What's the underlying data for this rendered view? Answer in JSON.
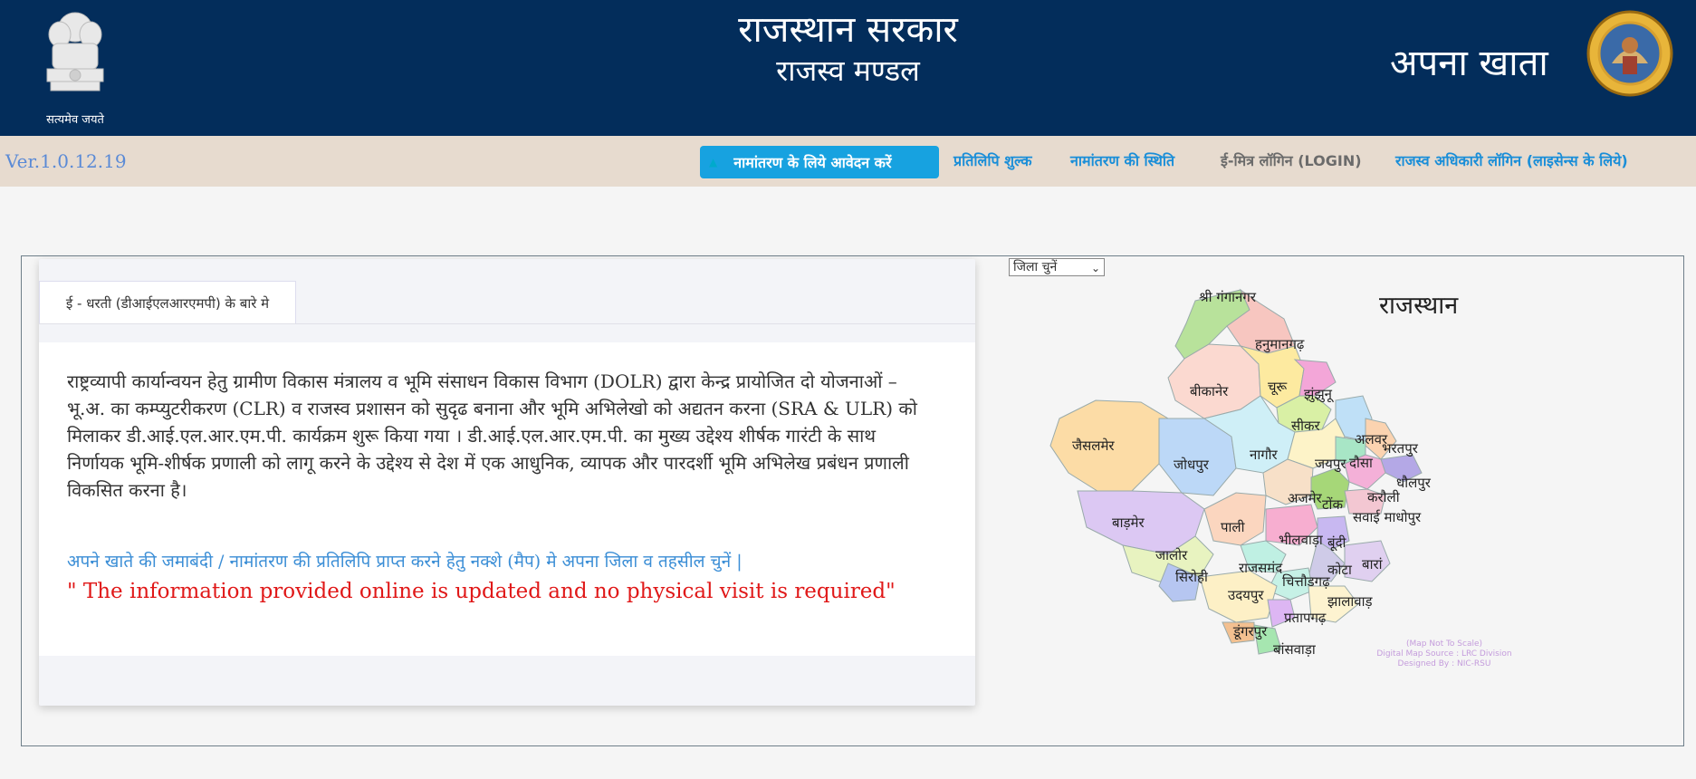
{
  "header": {
    "motto": "सत्यमेव जयते",
    "title": "राजस्थान सरकार",
    "subtitle": "राजस्व मण्डल",
    "right_title": "अपना खाता",
    "emblem_icon": "ashoka-emblem-icon",
    "seal_icon": "board-of-revenue-seal-icon",
    "bg_color": "#032d5b"
  },
  "nav": {
    "version": "Ver.1.0.12.19",
    "apply_label": "नामांतरण के लिये आवेदन करें",
    "copy_fee": "प्रतिलिपि शुल्क",
    "mutation_status": "नामांतरण की स्थिति",
    "emitra_login": "ई-मित्र लॉगिन (LOGIN)",
    "officer_login": "राजस्व अधिकारी लॉगिन (लाइसेन्स के लिये)",
    "accent_color": "#17a2e0"
  },
  "info": {
    "tab_label": "ई - धरती (डीआईएलआरएमपी) के बारे मे",
    "paragraph": "राष्ट्रव्यापी कार्यान्वयन हेतु ग्रामीण विकास मंत्रालय व भूमि संसाधन विकास विभाग (DOLR) द्वारा केन्द्र प्रायोजित दो योजनाओं – भू.अ. का कम्प्युटरीकरण (CLR) व राजस्व प्रशासन को सुदृढ बनाना और भूमि अभिलेखो को अद्यतन करना (SRA & ULR) को मिलाकर डी.आई.एल.आर.एम.पी. कार्यक्रम शुरू किया गया । डी.आई.एल.आर.एम.पी. का मुख्य उद्देश्य शीर्षक गारंटी के साथ निर्णायक भूमि-शीर्षक प्रणाली को लागू करने के उद्देश्य से देश में एक आधुनिक, व्यापक और पारदर्शी भूमि अभिलेख प्रबंधन प्रणाली विकसित करना है।",
    "note": "अपने खाते की जमाबंदी / नामांतरण की प्रतिलिपि प्राप्त करने हेतु नक्शे (मैप) मे अपना जिला व तहसील चुनें |",
    "quote": "\" The information provided online is updated and no physical visit is required\""
  },
  "map": {
    "select_placeholder": "जिला चुनें",
    "title": "राजस्थान",
    "credit": [
      "(Map Not To Scale)",
      "Digital Map Source : LRC Division",
      "Designed By : NIC-RSU"
    ],
    "districts": [
      "श्री गंगानगर",
      "हनुमानगढ़",
      "बीकानेर",
      "चूरू",
      "झुंझुनू",
      "सीकर",
      "अलवर",
      "भरतपुर",
      "धौलपुर",
      "जैसलमेर",
      "जोधपुर",
      "नागौर",
      "जयपुर",
      "दौसा",
      "करौली",
      "अजमेर",
      "टोंक",
      "सवाई माधोपुर",
      "बाड़मेर",
      "पाली",
      "भीलवाड़ा",
      "बूंदी",
      "जालोर",
      "राजसमंद",
      "कोटा",
      "बारां",
      "सिरोही",
      "चित्तौडगढ़",
      "उदयपुर",
      "झालावाड़",
      "प्रतापगढ़",
      "डूंगरपुर",
      "बांसवाड़ा"
    ]
  }
}
